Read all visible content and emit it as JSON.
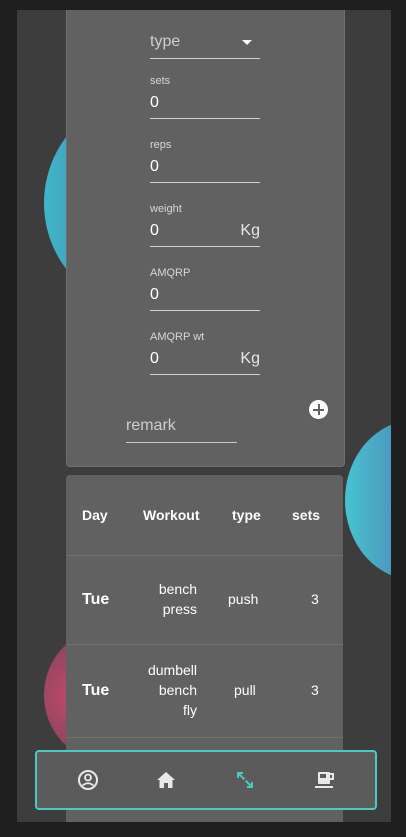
{
  "form": {
    "type_placeholder": "type",
    "sets_label": "sets",
    "sets_value": "0",
    "reps_label": "reps",
    "reps_value": "0",
    "weight_label": "weight",
    "weight_value": "0",
    "weight_unit": "Kg",
    "amqrp_label": "AMQRP",
    "amqrp_value": "0",
    "amqrp_wt_label": "AMQRP wt",
    "amqrp_wt_value": "0",
    "amqrp_wt_unit": "Kg",
    "remark_placeholder": "remark"
  },
  "table": {
    "headers": [
      "Day",
      "Workout",
      "type",
      "sets"
    ],
    "rows": [
      {
        "day": "Tue",
        "workout_lines": [
          "bench",
          "press"
        ],
        "type": "push",
        "sets": "3"
      },
      {
        "day": "Tue",
        "workout_lines": [
          "dumbell",
          "bench",
          "fly"
        ],
        "type": "pull",
        "sets": "3"
      }
    ]
  },
  "nav": {
    "items": [
      "account-icon",
      "home-icon",
      "swap-arrows-icon",
      "coffee-icon"
    ],
    "active_color": "#4ec9c0"
  }
}
